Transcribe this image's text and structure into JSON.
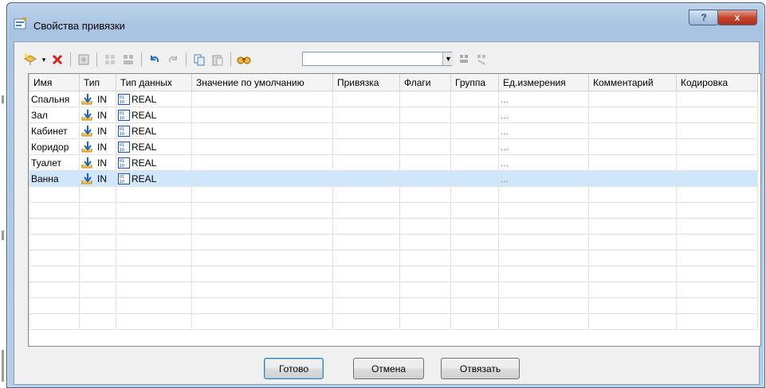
{
  "window": {
    "title": "Свойства привязки"
  },
  "titlebar_buttons": {
    "help": "?",
    "close": "x"
  },
  "toolbar": {
    "filter_value": "",
    "icons": [
      "add-variable-icon",
      "dropdown-arrow-icon",
      "delete-icon",
      "module-icon",
      "expand-icon",
      "collapse-icon",
      "undo-icon",
      "redo-icon",
      "copy-icon",
      "paste-icon",
      "find-icon",
      "filter-apply-icon",
      "filter-clear-icon"
    ]
  },
  "grid": {
    "columns": [
      "Имя",
      "Тип",
      "Тип данных",
      "Значение по умолчанию",
      "Привязка",
      "Флаги",
      "Группа",
      "Ед.измерения",
      "Комментарий",
      "Кодировка"
    ],
    "rows": [
      {
        "name": "Спальня",
        "type": "IN",
        "dtype": "REAL",
        "default": "",
        "binding": "",
        "flags": "",
        "group": "",
        "unit": "...",
        "comment": "",
        "encoding": ""
      },
      {
        "name": "Зал",
        "type": "IN",
        "dtype": "REAL",
        "default": "",
        "binding": "",
        "flags": "",
        "group": "",
        "unit": "...",
        "comment": "",
        "encoding": ""
      },
      {
        "name": "Кабинет",
        "type": "IN",
        "dtype": "REAL",
        "default": "",
        "binding": "",
        "flags": "",
        "group": "",
        "unit": "...",
        "comment": "",
        "encoding": ""
      },
      {
        "name": "Коридор",
        "type": "IN",
        "dtype": "REAL",
        "default": "",
        "binding": "",
        "flags": "",
        "group": "",
        "unit": "...",
        "comment": "",
        "encoding": ""
      },
      {
        "name": "Туалет",
        "type": "IN",
        "dtype": "REAL",
        "default": "",
        "binding": "",
        "flags": "",
        "group": "",
        "unit": "...",
        "comment": "",
        "encoding": ""
      },
      {
        "name": "Ванна",
        "type": "IN",
        "dtype": "REAL",
        "default": "",
        "binding": "",
        "flags": "",
        "group": "",
        "unit": "...",
        "comment": "",
        "encoding": ""
      }
    ],
    "selected_row": 5
  },
  "buttons": {
    "ok": "Готово",
    "cancel": "Отмена",
    "unbind": "Отвязать"
  },
  "colors": {
    "selection": "#cfe6fb",
    "close_button": "#c5452d"
  }
}
